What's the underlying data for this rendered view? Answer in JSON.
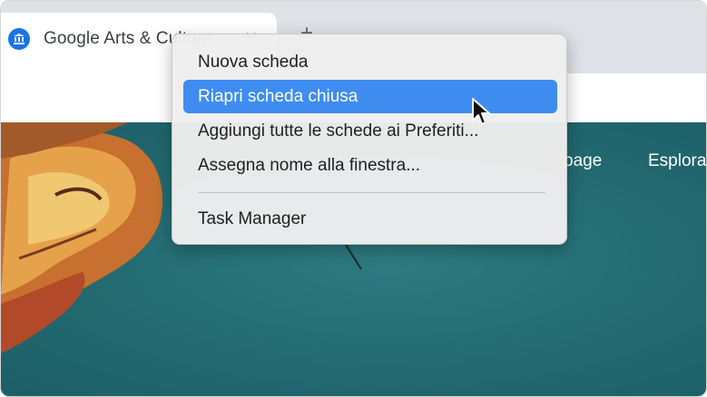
{
  "tab": {
    "title": "Google Arts & Culture",
    "icon": "museum-icon",
    "accent": "#1a73e8"
  },
  "page": {
    "nav_items": [
      "page",
      "Esplora"
    ]
  },
  "context_menu": {
    "items": [
      {
        "label": "Nuova scheda",
        "highlighted": false
      },
      {
        "label": "Riapri scheda chiusa",
        "highlighted": true
      },
      {
        "label": "Aggiungi tutte le schede ai Preferiti...",
        "highlighted": false
      },
      {
        "label": "Assegna nome alla finestra...",
        "highlighted": false
      },
      {
        "label": "Task Manager",
        "highlighted": false
      }
    ],
    "highlight_color": "#3f8cf1"
  }
}
